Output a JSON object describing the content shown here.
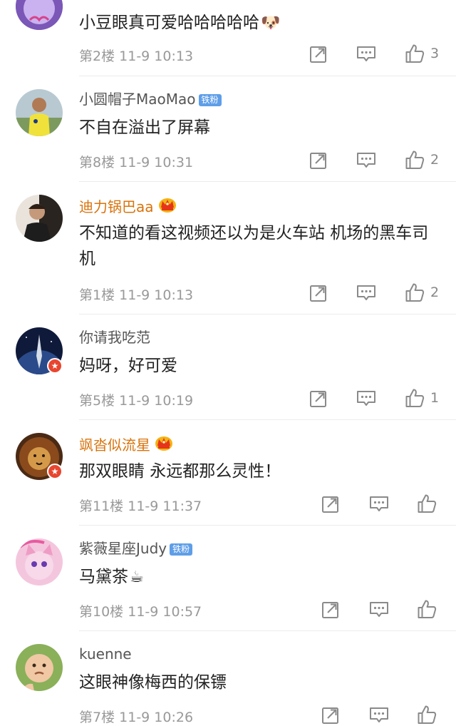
{
  "comments": [
    {
      "username": "",
      "text": "小豆眼真可爱哈哈哈哈哈",
      "emoji": "🐶",
      "floor": "第2楼",
      "time": "11-9 10:13",
      "likes": "3"
    },
    {
      "username": "小圆帽子MaoMao",
      "badge": "铁粉",
      "text": "不自在溢出了屏幕",
      "floor": "第8楼",
      "time": "11-9 10:31",
      "likes": "2"
    },
    {
      "username": "迪力锅巴aa",
      "text": "不知道的看这视频还以为是火车站 机场的黑车司机",
      "floor": "第1楼",
      "time": "11-9 10:13",
      "likes": "2"
    },
    {
      "username": "你请我吃范",
      "text": "妈呀，好可爱",
      "floor": "第5楼",
      "time": "11-9 10:19",
      "likes": "1"
    },
    {
      "username": "飒沓似流星",
      "text": "那双眼睛 永远都那么灵性！",
      "floor": "第11楼",
      "time": "11-9 11:37",
      "likes": ""
    },
    {
      "username": "紫薇星座Judy",
      "badge": "铁粉",
      "text": "马黛茶",
      "emoji": "☕",
      "floor": "第10楼",
      "time": "11-9 10:57",
      "likes": ""
    },
    {
      "username": "kuenne",
      "text": "这眼神像梅西的保镖",
      "floor": "第7楼",
      "time": "11-9 10:26",
      "likes": ""
    }
  ],
  "colors": {
    "vip_name": "#d8730c",
    "fan_badge": "#5e9ee8",
    "verified_badge": "#e8462f",
    "icon": "#8a8a8a"
  },
  "icons": {
    "share": "share-icon",
    "reply": "comment-reply-icon",
    "like": "thumbs-up-icon",
    "crown": "vip-crown-icon",
    "verified": "verified-star-icon"
  }
}
